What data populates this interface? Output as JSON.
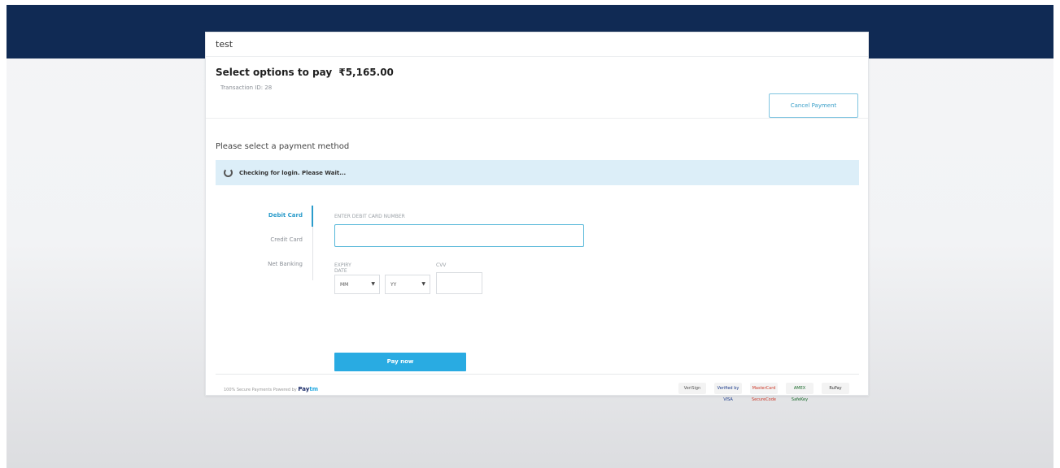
{
  "merchant": {
    "name": "test"
  },
  "summary": {
    "title": "Select options to pay",
    "amount": "₹5,165.00",
    "transaction": "Transaction ID: 28",
    "cancel_label": "Cancel Payment"
  },
  "payment": {
    "heading": "Please select a payment method",
    "checking_text": "Checking for login. Please Wait...",
    "tabs": [
      "Debit Card",
      "Credit Card",
      "Net Banking"
    ],
    "card_number_label": "ENTER DEBIT CARD NUMBER",
    "expiry_label": "EXPIRY DATE",
    "cvv_label": "CVV",
    "month_placeholder": "MM",
    "year_placeholder": "YY",
    "pay_label": "Pay now"
  },
  "footer": {
    "secure_text": "100% Secure Payments Powered by",
    "brand_pay": "Pay",
    "brand_tm": "tm",
    "logos": [
      "VeriSign",
      "Verified by VISA",
      "MasterCard SecureCode",
      "AMEX SafeKey",
      "RuPay"
    ]
  },
  "colors": {
    "top_band": "#102a54",
    "accent": "#29abe2",
    "info_bar": "#dceef8"
  }
}
